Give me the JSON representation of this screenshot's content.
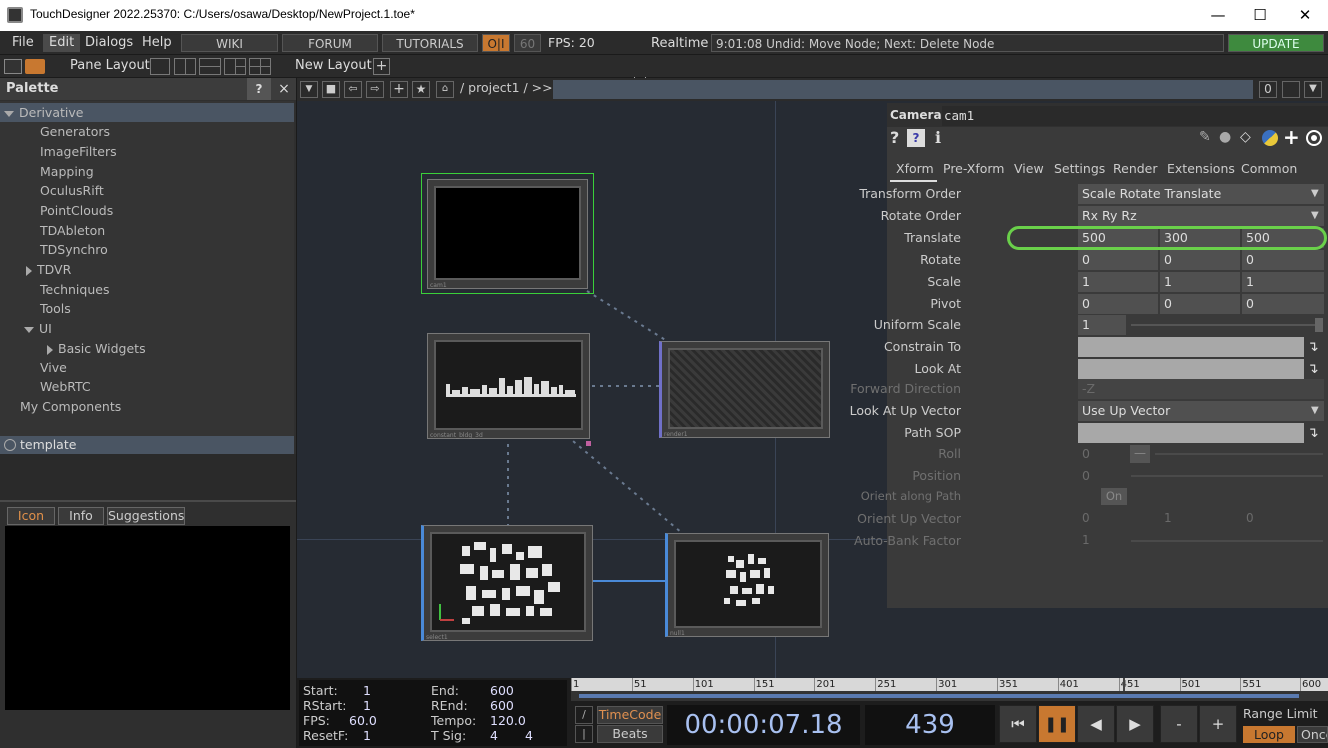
{
  "window": {
    "title": "TouchDesigner 2022.25370: C:/Users/osawa/Desktop/NewProject.1.toe*"
  },
  "menu": {
    "file": "File",
    "edit": "Edit",
    "dialogs": "Dialogs",
    "help": "Help",
    "wiki": "WIKI",
    "forum": "FORUM",
    "tutorials": "TUTORIALS",
    "oi": "O|I",
    "fps_cap": "60",
    "fps_label": "FPS:",
    "fps_value": "20",
    "realtime": "Realtime",
    "status": "9:01:08 Undid: Move Node; Next: Delete Node",
    "update": "UPDATE"
  },
  "toolbar": {
    "pane_layout": "Pane Layout",
    "new_layout": "New Layout"
  },
  "palette": {
    "title": "Palette",
    "help": "?",
    "close": "×",
    "root": "Derivative",
    "items": [
      "Generators",
      "ImageFilters",
      "Mapping",
      "OculusRift",
      "PointClouds",
      "TDAbleton",
      "TDSynchro",
      "TDVR",
      "Techniques",
      "Tools",
      "UI",
      "Basic Widgets",
      "Vive",
      "WebRTC",
      "My Components"
    ],
    "template": "template",
    "tabs": [
      "Icon",
      "Info",
      "Suggestions"
    ]
  },
  "network": {
    "path": "/ project1 / >>",
    "zoom": "0",
    "nodes": [
      "cam1",
      "constant_bldg_3d",
      "render1",
      "select1",
      "null1"
    ]
  },
  "params": {
    "type": "Camera",
    "name": "cam1",
    "tabs": [
      "Xform",
      "Pre-Xform",
      "View",
      "Settings",
      "Render",
      "Extensions",
      "Common"
    ],
    "rows": [
      {
        "label": "Transform Order",
        "value": "Scale Rotate Translate"
      },
      {
        "label": "Rotate Order",
        "value": "Rx Ry Rz"
      },
      {
        "label": "Translate",
        "v1": "500",
        "v2": "300",
        "v3": "500"
      },
      {
        "label": "Rotate",
        "v1": "0",
        "v2": "0",
        "v3": "0"
      },
      {
        "label": "Scale",
        "v1": "1",
        "v2": "1",
        "v3": "1"
      },
      {
        "label": "Pivot",
        "v1": "0",
        "v2": "0",
        "v3": "0"
      },
      {
        "label": "Uniform Scale",
        "value": "1"
      },
      {
        "label": "Constrain To"
      },
      {
        "label": "Look At"
      },
      {
        "label": "Forward Direction",
        "value": "-Z"
      },
      {
        "label": "Look At Up Vector",
        "value": "Use Up Vector"
      },
      {
        "label": "Path SOP"
      },
      {
        "label": "Roll",
        "value": "0"
      },
      {
        "label": "Position",
        "value": "0"
      },
      {
        "label": "Orient along Path",
        "value": "On"
      },
      {
        "label": "Orient Up Vector",
        "v1": "0",
        "v2": "1",
        "v3": "0"
      },
      {
        "label": "Auto-Bank Factor",
        "value": "1"
      }
    ]
  },
  "timeline": {
    "start_l": "Start:",
    "start": "1",
    "end_l": "End:",
    "end": "600",
    "rstart_l": "RStart:",
    "rstart": "1",
    "rend_l": "REnd:",
    "rend": "600",
    "fps_l": "FPS:",
    "fps": "60.0",
    "tempo_l": "Tempo:",
    "tempo": "120.0",
    "resetf_l": "ResetF:",
    "resetf": "1",
    "tsig_l": "T Sig:",
    "tsig1": "4",
    "tsig2": "4",
    "ticks": [
      "1",
      "51",
      "101",
      "151",
      "201",
      "251",
      "301",
      "351",
      "401",
      "451",
      "501",
      "551",
      "600"
    ],
    "timecode_btn": "TimeCode",
    "beats_btn": "Beats",
    "timecode": "00:00:07.18",
    "frame": "439",
    "range_limit": "Range Limit",
    "loop": "Loop",
    "once": "Once",
    "minus": "-",
    "plus": "+"
  }
}
